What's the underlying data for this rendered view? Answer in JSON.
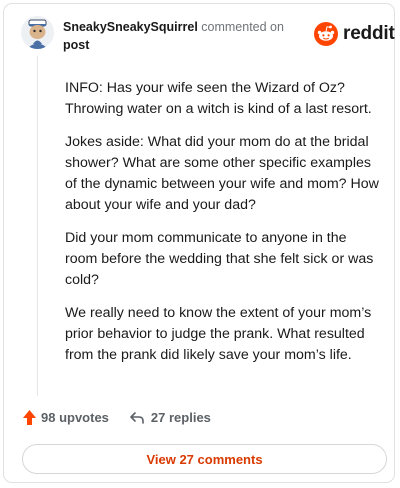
{
  "header": {
    "username": "SneakySneakySquirrel",
    "action": "commented on",
    "target": "post"
  },
  "brand": {
    "name": "reddit",
    "color": "#ff4500"
  },
  "comment": {
    "paragraphs": [
      "INFO: Has your wife seen the Wizard of Oz? Throwing water on a witch is kind of a last resort.",
      "Jokes aside: What did your mom do at the bridal shower? What are some other specific examples of the dynamic between your wife and mom? How about your wife and your dad?",
      "Did your mom communicate to anyone in the room before the wedding that she felt sick or was cold?",
      "We really need to know the extent of your mom’s prior behavior to judge the prank. What resulted from the prank did likely save your mom’s life."
    ]
  },
  "actions": {
    "upvote_icon": "upvote-arrow-icon",
    "upvotes": "98 upvotes",
    "reply_icon": "reply-arrow-icon",
    "replies": "27 replies"
  },
  "view_button": {
    "label": "View 27 comments"
  },
  "colors": {
    "accent": "#d93a00",
    "upvote": "#ff4500"
  }
}
